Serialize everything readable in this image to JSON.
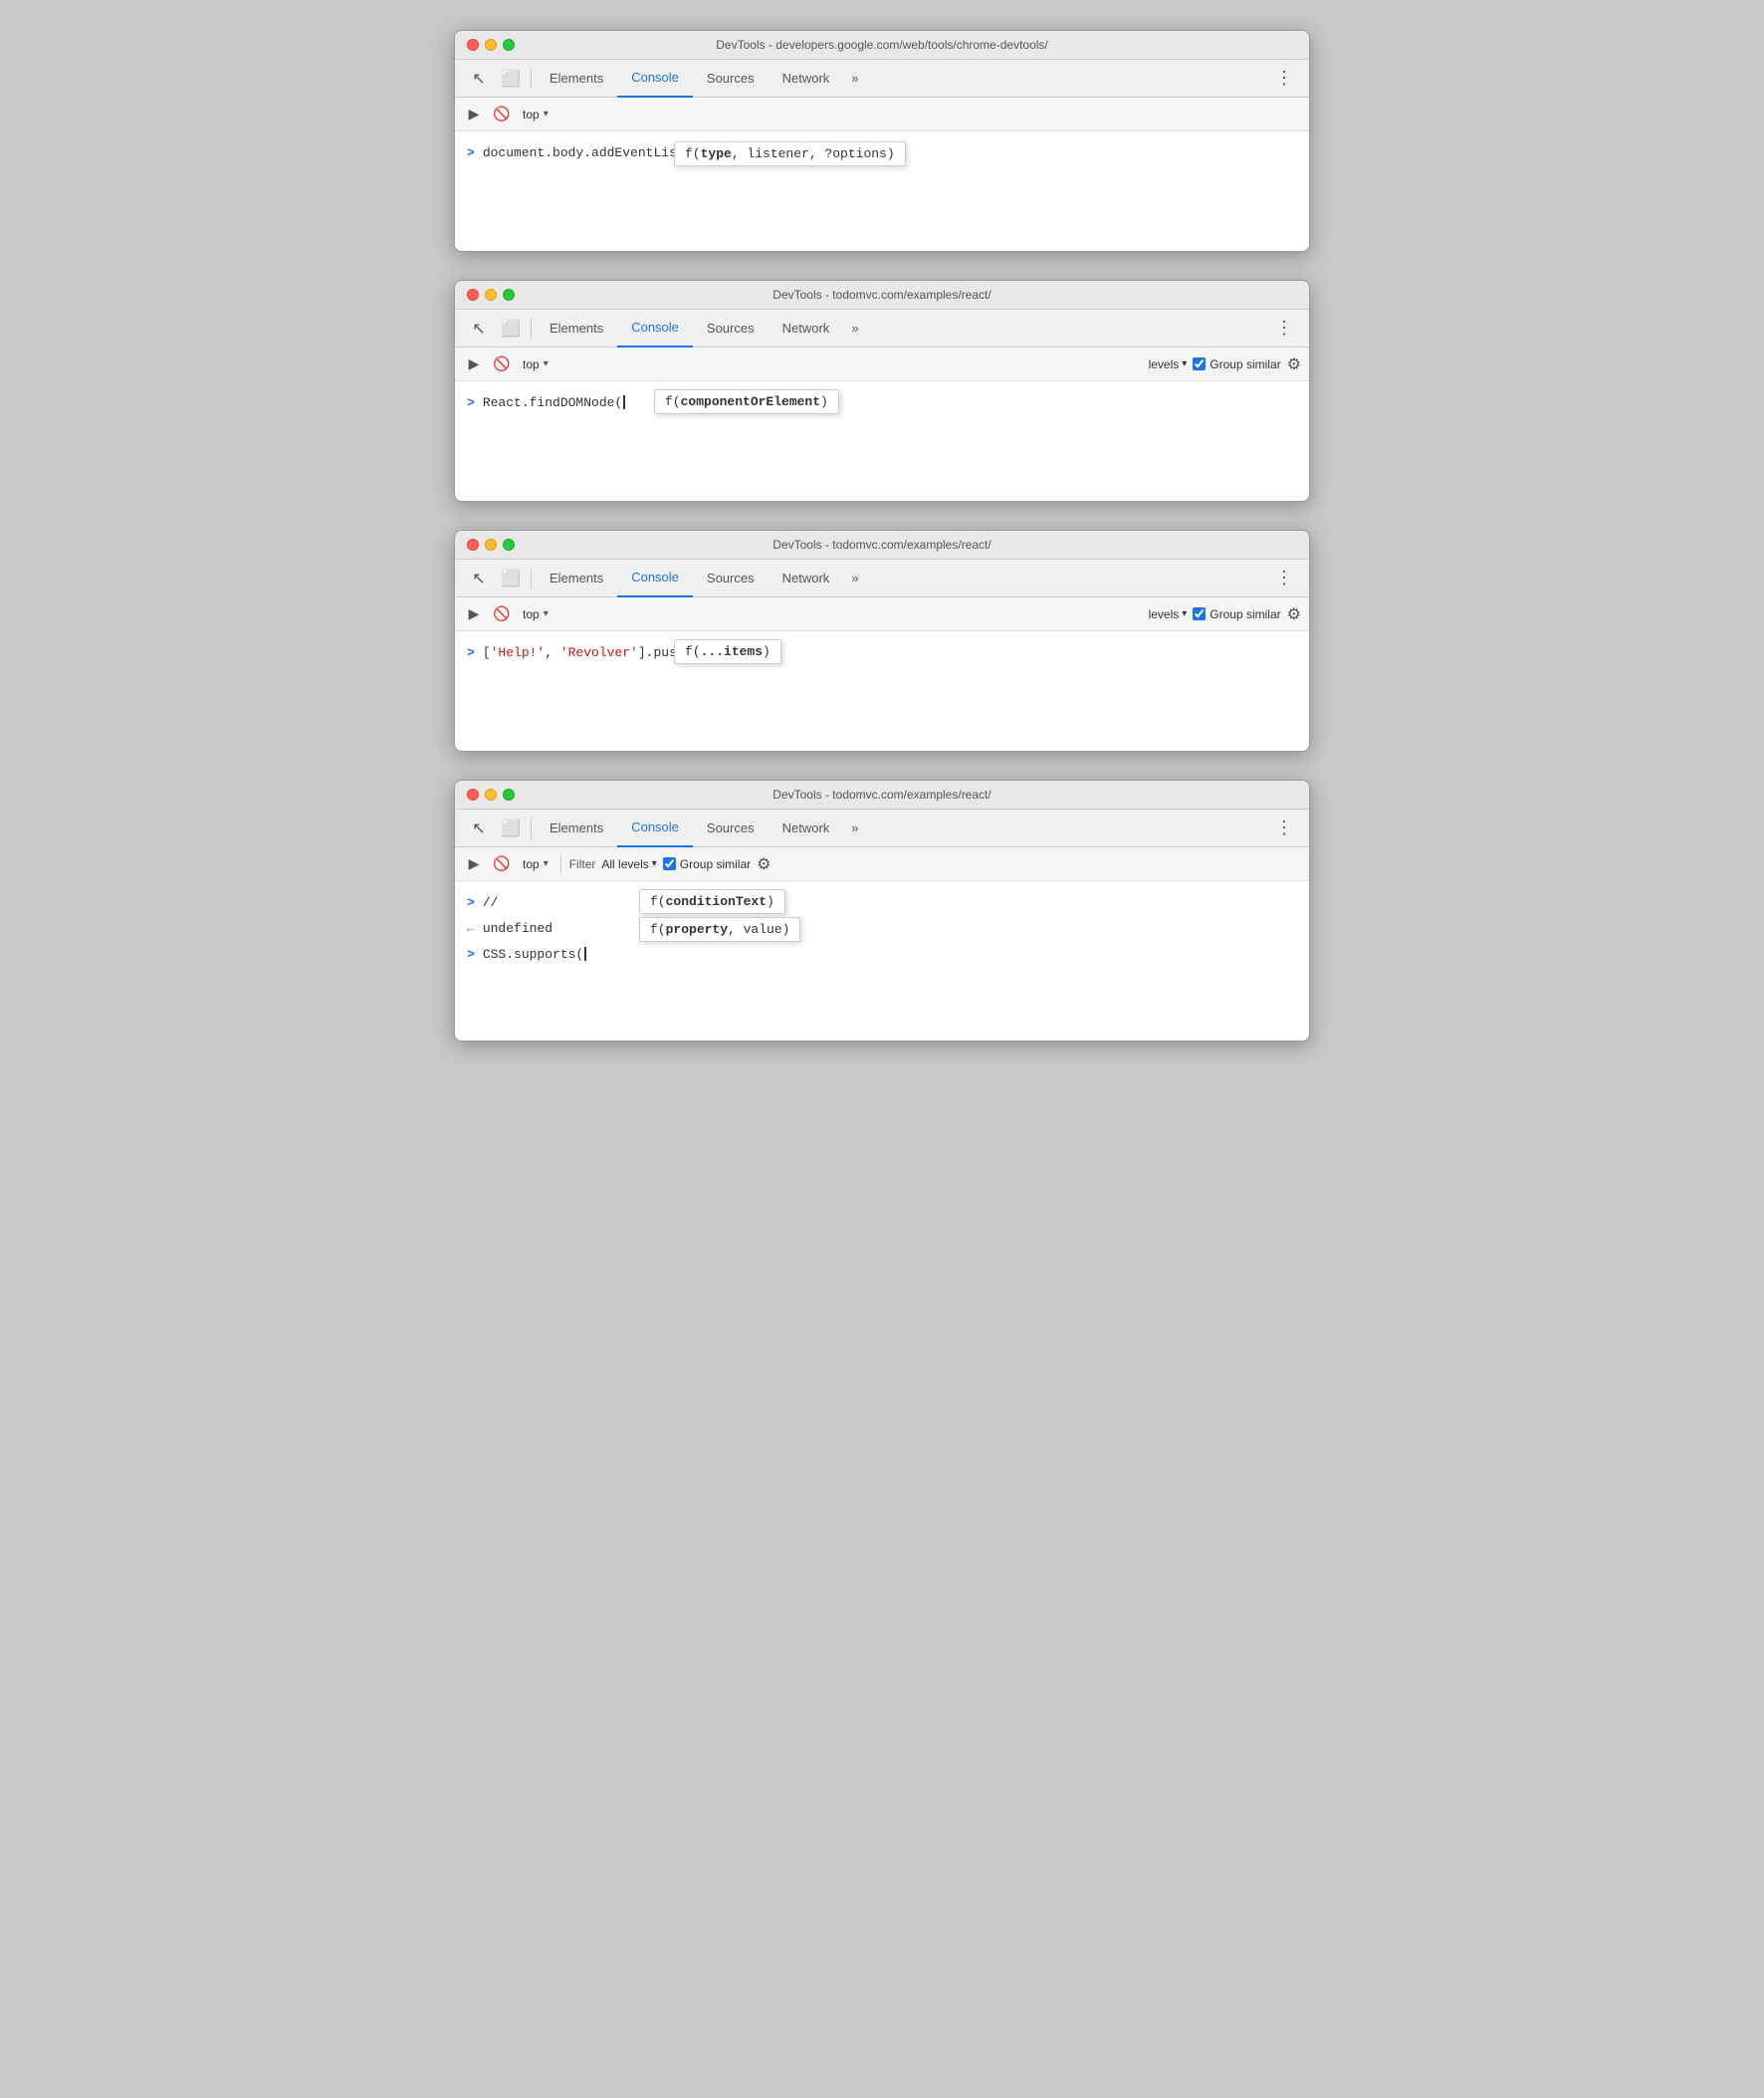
{
  "windows": [
    {
      "id": "window-1",
      "title": "DevTools - developers.google.com/web/tools/chrome-devtools/",
      "tabs": [
        "Elements",
        "Console",
        "Sources",
        "Network",
        "»"
      ],
      "active_tab": "Console",
      "toolbar": {
        "has_filter": false,
        "has_levels": false,
        "has_group_similar": false,
        "has_filter_placeholder": false
      },
      "console_rows": [
        {
          "type": "input",
          "prompt": ">",
          "code": "document.body.addEventListener(",
          "cursor": true
        }
      ],
      "tooltip": {
        "text_before": "f(",
        "bold": "type",
        "text_after": ", listener, ?options)"
      },
      "tooltip2": null
    },
    {
      "id": "window-2",
      "title": "DevTools - todomvc.com/examples/react/",
      "tabs": [
        "Elements",
        "Console",
        "Sources",
        "Network",
        "»"
      ],
      "active_tab": "Console",
      "toolbar": {
        "has_filter": false,
        "has_levels": true,
        "has_group_similar": true,
        "filter_text": ""
      },
      "console_rows": [
        {
          "type": "input",
          "prompt": ">",
          "code": "React.findDOMNode(",
          "cursor": true
        }
      ],
      "tooltip": {
        "text_before": "f(",
        "bold": "componentOrElement",
        "text_after": ")"
      },
      "tooltip2": null
    },
    {
      "id": "window-3",
      "title": "DevTools - todomvc.com/examples/react/",
      "tabs": [
        "Elements",
        "Console",
        "Sources",
        "Network",
        "»"
      ],
      "active_tab": "Console",
      "toolbar": {
        "has_filter": false,
        "has_levels": true,
        "has_group_similar": true,
        "filter_text": ""
      },
      "console_rows": [
        {
          "type": "input",
          "prompt": ">",
          "code_parts": [
            {
              "text": "[",
              "class": ""
            },
            {
              "text": "'Help!'",
              "class": "string"
            },
            {
              "text": ", ",
              "class": ""
            },
            {
              "text": "'Revolver'",
              "class": "string"
            },
            {
              "text": "].push(",
              "class": ""
            }
          ],
          "cursor": true
        }
      ],
      "tooltip": {
        "text_before": "f(",
        "bold": "...items",
        "text_after": ")"
      },
      "tooltip2": null
    },
    {
      "id": "window-4",
      "title": "DevTools - todomvc.com/examples/react/",
      "tabs": [
        "Elements",
        "Console",
        "Sources",
        "Network",
        "»"
      ],
      "active_tab": "Console",
      "toolbar": {
        "has_filter": true,
        "has_levels": true,
        "has_group_similar": true,
        "filter_text": "Filter",
        "levels_text": "All levels"
      },
      "console_rows": [
        {
          "type": "input",
          "prompt": ">",
          "code": "//",
          "code_class": "comment",
          "cursor": false
        },
        {
          "type": "output",
          "prompt": "←",
          "code": "undefined",
          "code_class": "undefined-val",
          "cursor": false
        },
        {
          "type": "input",
          "prompt": ">",
          "code": "CSS.supports(",
          "cursor": true
        }
      ],
      "tooltip": {
        "text_before": "f(",
        "bold": "conditionText",
        "text_after": ")"
      },
      "tooltip2": {
        "text_before": "f(",
        "bold": "property",
        "text_after": ", value)"
      }
    }
  ],
  "labels": {
    "elements": "Elements",
    "console": "Console",
    "sources": "Sources",
    "network": "Network",
    "more": "»",
    "top": "top",
    "filter": "Filter",
    "all_levels": "All levels",
    "group_similar": "Group similar"
  }
}
